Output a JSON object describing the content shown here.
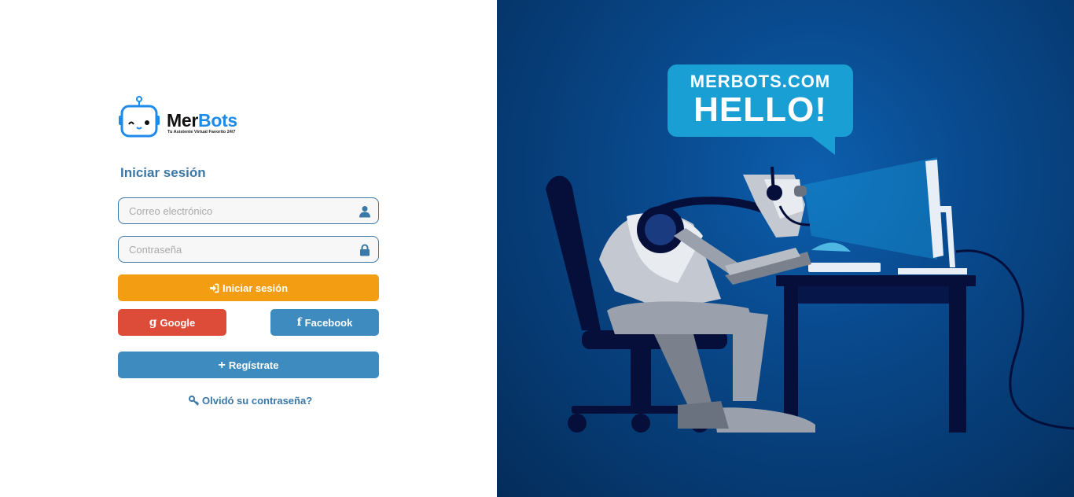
{
  "brand": {
    "name_part1": "Mer",
    "name_part2": "Bots",
    "tagline": "Tu Asistente Virtual Favorito 24/7"
  },
  "login": {
    "title": "Iniciar sesión",
    "email_placeholder": "Correo electrónico",
    "password_placeholder": "Contraseña",
    "login_button": "Iniciar sesión",
    "google_button": "Google",
    "facebook_button": "Facebook",
    "register_button": "Regístrate",
    "forgot_link": "Olvidó su contraseña?"
  },
  "hero": {
    "bubble_line1": "MERBOTS.COM",
    "bubble_line2": "HELLO!"
  },
  "colors": {
    "primary_blue": "#3a78a8",
    "login_orange": "#f29d12",
    "google_red": "#dd4b39",
    "facebook_blue": "#3d8bbf",
    "hero_bg": "#094a8e",
    "bubble": "#1a9fd4"
  },
  "icons": {
    "email_field": "user-icon",
    "password_field": "lock-icon",
    "login_button": "sign-in-icon",
    "google_button": "google-icon",
    "facebook_button": "facebook-icon",
    "register_button": "plus-icon",
    "forgot_link": "key-icon"
  }
}
